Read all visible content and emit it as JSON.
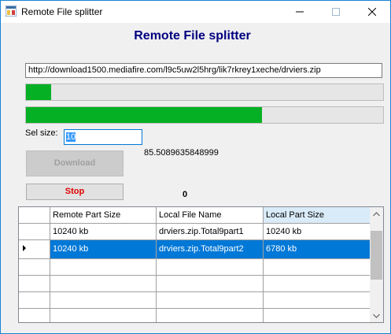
{
  "window": {
    "title": "Remote File splitter"
  },
  "heading": "Remote File splitter",
  "url": "http://download1500.mediafire.com/l9c5uw2l5hrg/lik7rkrey1xeche/drviers.zip",
  "progress": {
    "top_fraction": 0.07,
    "bottom_fraction": 0.66
  },
  "sel_size": {
    "label": "Sel size:",
    "value": "10"
  },
  "ratio": "85.5089635848999",
  "buttons": {
    "download": "Download",
    "stop": "Stop"
  },
  "counter": "0",
  "grid": {
    "columns": [
      "Remote Part Size",
      "Local File Name",
      "Local Part Size"
    ],
    "rows": [
      [
        "10240 kb",
        "drviers.zip.Total9part1",
        "10240 kb"
      ],
      [
        "10240 kb",
        "drviers.zip.Total9part2",
        "6780 kb"
      ]
    ]
  },
  "colors": {
    "progress": "#06b025",
    "selection": "#0078d7",
    "heading": "#000080",
    "stop": "#e00000"
  },
  "icons": [
    "app-icon",
    "minimize-icon",
    "maximize-icon",
    "close-icon",
    "row-pointer-icon",
    "scroll-up-icon",
    "scroll-down-icon"
  ]
}
